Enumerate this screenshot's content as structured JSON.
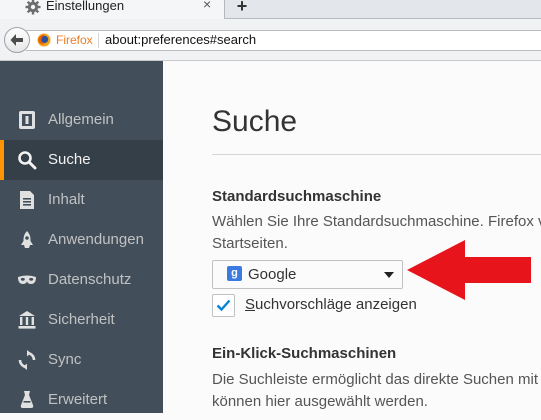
{
  "tab": {
    "title": "Einstellungen",
    "close": "×",
    "new_tab": "+"
  },
  "navbar": {
    "identity_label": "Firefox",
    "url": "about:preferences#search"
  },
  "sidebar": {
    "items": [
      {
        "label": "Allgemein",
        "icon": "general-icon"
      },
      {
        "label": "Suche",
        "icon": "search-icon",
        "selected": true
      },
      {
        "label": "Inhalt",
        "icon": "content-icon"
      },
      {
        "label": "Anwendungen",
        "icon": "applications-icon"
      },
      {
        "label": "Datenschutz",
        "icon": "privacy-mask-icon"
      },
      {
        "label": "Sicherheit",
        "icon": "security-icon"
      },
      {
        "label": "Sync",
        "icon": "sync-icon"
      },
      {
        "label": "Erweitert",
        "icon": "advanced-icon"
      }
    ]
  },
  "main": {
    "title": "Suche",
    "default_engine": {
      "heading": "Standardsuchmaschine",
      "description_line1": "Wählen Sie Ihre Standardsuchmaschine. Firefox ve",
      "description_line2": "Startseiten.",
      "selected_engine": "Google",
      "engine_icon_letter": "g",
      "suggestions_checkbox": {
        "checked": true,
        "label_mnemonic": "S",
        "label_rest": "uchvorschläge anzeigen"
      }
    },
    "one_click": {
      "heading": "Ein-Klick-Suchmaschinen",
      "description_line1": "Die Suchleiste ermöglicht das direkte Suchen mit e",
      "description_line2": "können hier ausgewählt werden."
    }
  },
  "colors": {
    "sidebar_bg": "#424f5a",
    "sidebar_selected_bg": "#343f48",
    "accent": "#ff9500",
    "annotation_arrow": "#e8141b",
    "checkbox_blue": "#0a84d6"
  }
}
